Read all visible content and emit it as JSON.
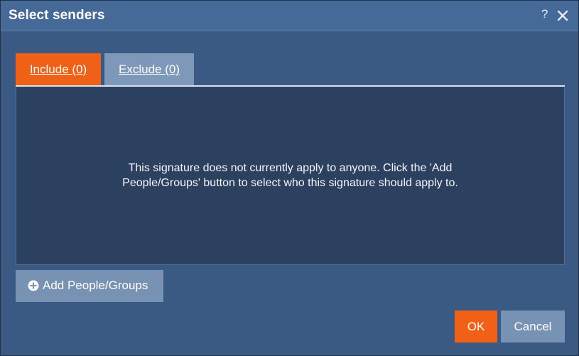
{
  "dialog": {
    "title": "Select senders",
    "help_glyph": "?",
    "icons": {
      "help": "help-icon",
      "close": "close-icon",
      "add": "plus-circle-icon"
    }
  },
  "tabs": [
    {
      "label": "Include (0)",
      "active": true
    },
    {
      "label": "Exclude (0)",
      "active": false
    }
  ],
  "panel": {
    "empty_message": "This signature does not currently apply to anyone. Click the 'Add People/Groups' button to select who this signature should apply to."
  },
  "actions": {
    "add_label": "Add People/Groups",
    "ok_label": "OK",
    "cancel_label": "Cancel"
  },
  "colors": {
    "accent": "#f06016",
    "secondary_button": "#7892b3",
    "dialog_bg": "#3b5a83",
    "titlebar_bg": "#466a97",
    "panel_bg": "#2c4060"
  }
}
